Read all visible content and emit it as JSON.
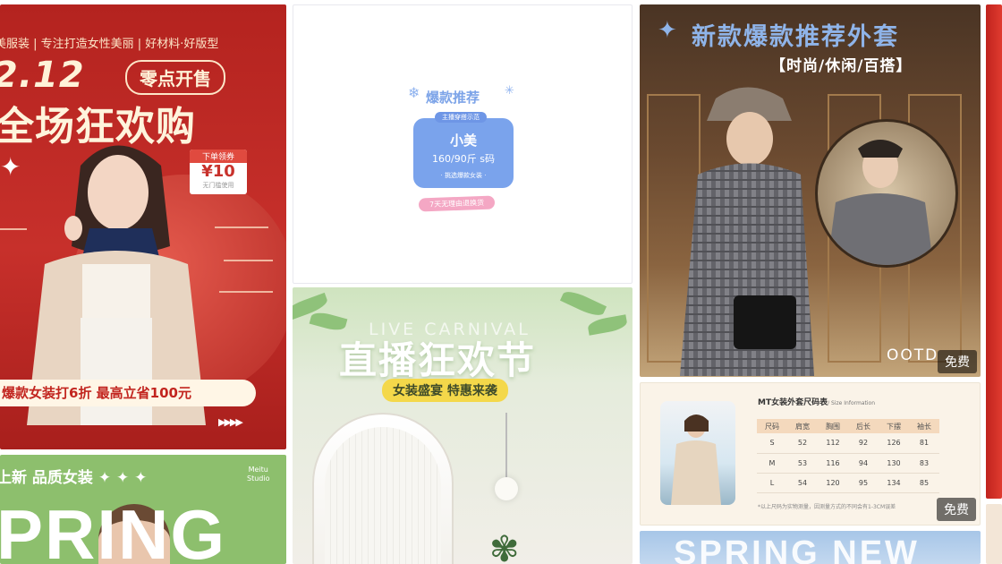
{
  "cards": {
    "sale_1212": {
      "top_line": "美服装 | 专注打造女性美丽 | 好材料·好版型",
      "date": "2.12",
      "sale_pill": "零点开售",
      "headline": "全场狂欢购",
      "coupon_title": "下单领券",
      "coupon_value": "¥10",
      "coupon_sub": "无门槛使用",
      "bottom_text": "爆款女装打6折  最高立省100元",
      "arrows": "▶▶▶▶"
    },
    "hot_recommend": {
      "title": "爆款推荐",
      "small_pill": "主播穿搭示范",
      "name": "小美",
      "stats": "160/90斤  s码",
      "desc": "· 挑选爆款女装 ·",
      "pink": "7天无理由退换货"
    },
    "live_carnival": {
      "english": "LIVE CARNIVAL",
      "title": "直播狂欢节",
      "subtitle": "女装盛宴  特惠来袭"
    },
    "spring": {
      "title": "上新 品质女装 ✦ ✦ ✦",
      "studio": "Meitu\nStudio",
      "big": "PRING"
    },
    "outfit": {
      "title": "新款爆款推荐外套",
      "subtitle": "【时尚/休闲/百搭】",
      "ootd": "OOTD",
      "free": "免费"
    },
    "size_chart": {
      "title": "MT女装外套尺码表",
      "title_en": "/ Size Information",
      "headers": [
        "尺码",
        "肩宽",
        "胸围",
        "后长",
        "下摆",
        "袖长"
      ],
      "rows": [
        [
          "S",
          "52",
          "112",
          "92",
          "126",
          "81"
        ],
        [
          "M",
          "53",
          "116",
          "94",
          "130",
          "83"
        ],
        [
          "L",
          "54",
          "120",
          "95",
          "134",
          "85"
        ]
      ],
      "note": "*以上尺码为实物测量，因测量方式的不同会有1-3CM误差",
      "free": "免费"
    },
    "spring_new": {
      "title": "SPRING NEW"
    }
  },
  "colors": {
    "sale_red": "#c7302b",
    "cream": "#fff4dc",
    "blue_accent": "#7aa3ec",
    "green": "#8dbf6d",
    "outfit_blue": "#8fb4e9"
  }
}
